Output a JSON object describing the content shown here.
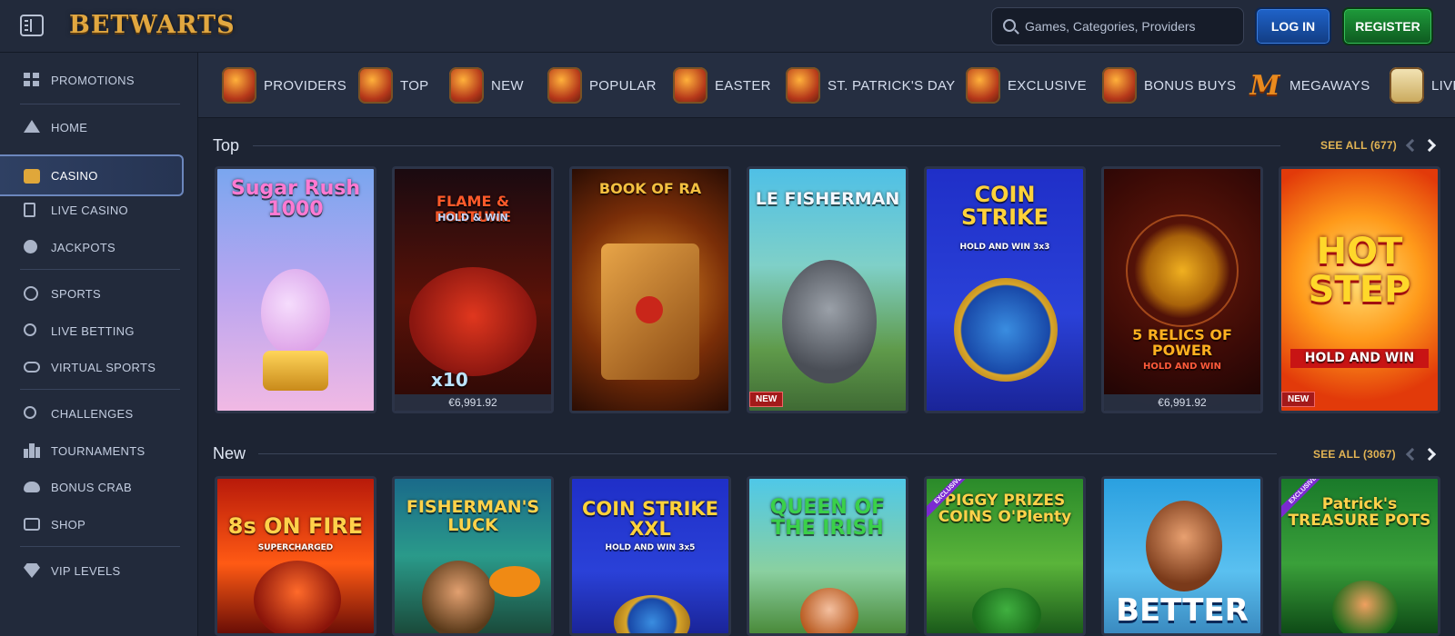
{
  "header": {
    "logo_text": "BETWARTS",
    "search_placeholder": "Games, Categories, Providers",
    "login_label": "LOG IN",
    "register_label": "REGISTER",
    "colors": {
      "login": "#1f63c9",
      "register": "#1e9a3a",
      "accent": "#e2b454"
    }
  },
  "sidebar": {
    "items": [
      {
        "label": "PROMOTIONS",
        "icon": "promotions-grid-icon"
      },
      {
        "label": "HOME",
        "icon": "wizard-hat-icon"
      },
      {
        "label": "CASINO",
        "icon": "treasure-chest-icon",
        "active": true
      },
      {
        "label": "LIVE CASINO",
        "icon": "playing-card-icon"
      },
      {
        "label": "JACKPOTS",
        "icon": "clover-icon"
      },
      {
        "label": "SPORTS",
        "icon": "football-icon"
      },
      {
        "label": "LIVE BETTING",
        "icon": "live-betting-icon"
      },
      {
        "label": "VIRTUAL SPORTS",
        "icon": "gamepad-icon"
      },
      {
        "label": "CHALLENGES",
        "icon": "location-pin-icon"
      },
      {
        "label": "TOURNAMENTS",
        "icon": "podium-icon"
      },
      {
        "label": "BONUS CRAB",
        "icon": "crab-icon"
      },
      {
        "label": "SHOP",
        "icon": "shopping-bag-icon"
      },
      {
        "label": "VIP LEVELS",
        "icon": "diamond-icon"
      }
    ]
  },
  "categories": [
    {
      "label": "PROVIDERS"
    },
    {
      "label": "TOP"
    },
    {
      "label": "NEW"
    },
    {
      "label": "POPULAR"
    },
    {
      "label": "EASTER"
    },
    {
      "label": "ST. PATRICK'S DAY"
    },
    {
      "label": "EXCLUSIVE"
    },
    {
      "label": "BONUS BUYS"
    },
    {
      "label": "MEGAWAYS",
      "icon_text": "M"
    },
    {
      "label": "LIVE"
    }
  ],
  "sections": {
    "top": {
      "title": "Top",
      "see_all": "SEE ALL (677)",
      "games": [
        {
          "title": "Sugar Rush 1000"
        },
        {
          "title": "FLAME & FORTUNE",
          "subtitle": "HOLD & WIN",
          "extra": "x10",
          "jackpot": "€6,991.92"
        },
        {
          "title": "BOOK OF RA"
        },
        {
          "title": "LE FISHERMAN",
          "badge": "NEW"
        },
        {
          "title": "COIN STRIKE",
          "subtitle": "HOLD AND WIN 3x3"
        },
        {
          "title": "5 RELICS OF POWER",
          "subtitle": "HOLD AND WIN",
          "jackpot": "€6,991.92"
        },
        {
          "title": "HOT STEP",
          "subtitle": "HOLD AND WIN",
          "badge": "NEW"
        }
      ]
    },
    "new": {
      "title": "New",
      "see_all": "SEE ALL (3067)",
      "games": [
        {
          "title": "8s ON FIRE",
          "subtitle": "SUPERCHARGED"
        },
        {
          "title": "FISHERMAN'S LUCK"
        },
        {
          "title": "COIN STRIKE XXL",
          "subtitle": "HOLD AND WIN 3x5"
        },
        {
          "title": "QUEEN OF THE IRISH"
        },
        {
          "title": "PIGGY PRIZES COINS O'Plenty",
          "badge": "EXCLUSIVE"
        },
        {
          "title": "BETTER"
        },
        {
          "title": "Patrick's TREASURE POTS",
          "badge": "EXCLUSIVE"
        }
      ]
    }
  }
}
